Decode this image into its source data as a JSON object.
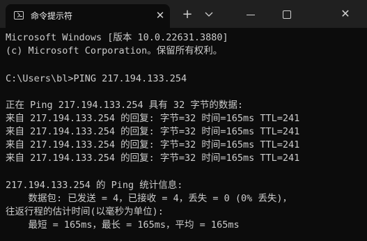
{
  "window": {
    "tab_title": "命令提示符",
    "tab_close_glyph": "✕",
    "new_tab_glyph": "+",
    "close_glyph": "✕",
    "icons": [
      "cmd-icon",
      "close-icon",
      "plus-icon",
      "chevron-down-icon",
      "minimize-icon",
      "maximize-icon",
      "close-icon"
    ]
  },
  "console": {
    "lines": [
      "Microsoft Windows [版本 10.0.22631.3880]",
      "(c) Microsoft Corporation。保留所有权利。",
      "",
      "C:\\Users\\bl>PING 217.194.133.254",
      "",
      "正在 Ping 217.194.133.254 具有 32 字节的数据:",
      "来自 217.194.133.254 的回复: 字节=32 时间=165ms TTL=241",
      "来自 217.194.133.254 的回复: 字节=32 时间=165ms TTL=241",
      "来自 217.194.133.254 的回复: 字节=32 时间=165ms TTL=241",
      "来自 217.194.133.254 的回复: 字节=32 时间=165ms TTL=241",
      "",
      "217.194.133.254 的 Ping 统计信息:",
      "    数据包: 已发送 = 4，已接收 = 4，丢失 = 0 (0% 丢失)，",
      "往返行程的估计时间(以毫秒为单位):",
      "    最短 = 165ms，最长 = 165ms，平均 = 165ms"
    ]
  },
  "colors": {
    "console_background": "#0c0c0c",
    "titlebar_background": "#202020",
    "text": "#cccccc"
  }
}
